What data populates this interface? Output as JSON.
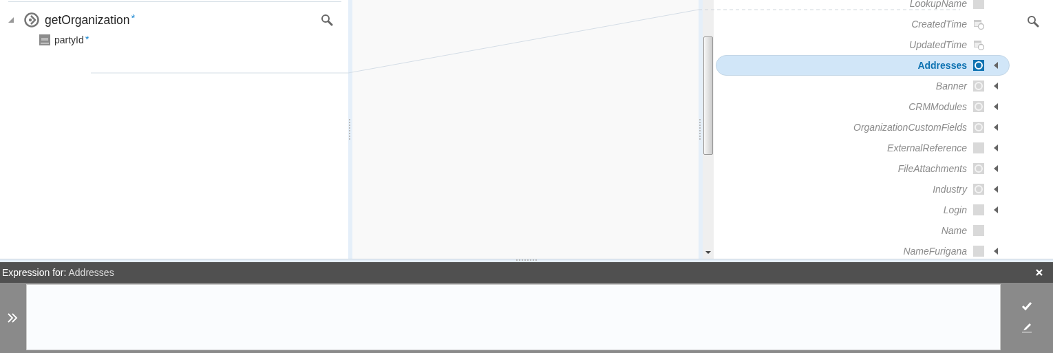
{
  "source_tree": {
    "root": {
      "label": "getOrganization",
      "required_mark": "*",
      "expanded": true,
      "children": [
        {
          "label": "partyId",
          "required_mark": "*",
          "kind": "number"
        }
      ]
    }
  },
  "target_list": {
    "items": [
      {
        "label": "LookupName",
        "kind": "text",
        "expandable": false,
        "selected": false
      },
      {
        "label": "CreatedTime",
        "kind": "date",
        "expandable": false,
        "selected": false
      },
      {
        "label": "UpdatedTime",
        "kind": "date",
        "expandable": false,
        "selected": false
      },
      {
        "label": "Addresses",
        "kind": "object",
        "expandable": true,
        "selected": true
      },
      {
        "label": "Banner",
        "kind": "object",
        "expandable": true,
        "selected": false
      },
      {
        "label": "CRMModules",
        "kind": "object",
        "expandable": true,
        "selected": false
      },
      {
        "label": "OrganizationCustomFields",
        "kind": "object",
        "expandable": true,
        "selected": false
      },
      {
        "label": "ExternalReference",
        "kind": "text",
        "expandable": true,
        "selected": false
      },
      {
        "label": "FileAttachments",
        "kind": "object",
        "expandable": true,
        "selected": false
      },
      {
        "label": "Industry",
        "kind": "object",
        "expandable": true,
        "selected": false
      },
      {
        "label": "Login",
        "kind": "text",
        "expandable": true,
        "selected": false
      },
      {
        "label": "Name",
        "kind": "text",
        "expandable": false,
        "selected": false
      },
      {
        "label": "NameFurigana",
        "kind": "text",
        "expandable": true,
        "selected": false
      }
    ]
  },
  "expression_panel": {
    "prefix": "Expression for:",
    "target": "Addresses"
  }
}
